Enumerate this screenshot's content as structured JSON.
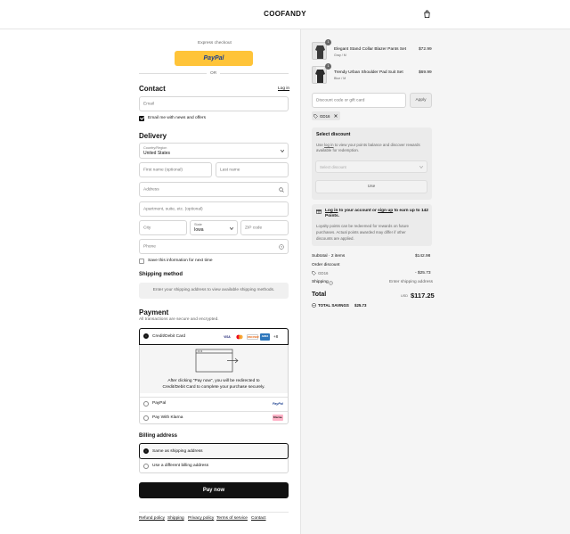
{
  "header": {
    "brand": "COOFANDY",
    "cart_icon": "shopping-bag-icon"
  },
  "express": {
    "label": "Express checkout",
    "paypal_label": "PayPal",
    "or": "OR"
  },
  "contact": {
    "title": "Contact",
    "login": "Log in",
    "email_placeholder": "Email",
    "newsletter_label": "Email me with news and offers",
    "newsletter_checked": true
  },
  "delivery": {
    "title": "Delivery",
    "country_label": "Country/Region",
    "country_value": "United States",
    "first_name_placeholder": "First name (optional)",
    "last_name_placeholder": "Last name",
    "address_placeholder": "Address",
    "apartment_placeholder": "Apartment, suite, etc. (optional)",
    "city_placeholder": "City",
    "state_label": "State",
    "state_value": "Iowa",
    "zip_placeholder": "ZIP code",
    "phone_placeholder": "Phone",
    "save_info_label": "Save this information for next time"
  },
  "shipping_method": {
    "title": "Shipping method",
    "message": "Enter your shipping address to view available shipping methods."
  },
  "payment": {
    "title": "Payment",
    "subtitle": "All transactions are secure and encrypted.",
    "card_label": "Credit/Debit Card",
    "card_brands": [
      "VISA",
      "MC",
      "DISCOVER",
      "AMEX"
    ],
    "more_brands": "+8",
    "redirect_text_1": "After clicking “Pay now”, you will be redirected to",
    "redirect_text_2": "Credit/Debit Card to complete your purchase securely.",
    "paypal_label": "PayPal",
    "paypal_logo": "PayPal",
    "klarna_label": "Pay With Klarna",
    "klarna_logo": "Klarna."
  },
  "billing": {
    "title": "Billing address",
    "same_label": "Same as shipping address",
    "different_label": "Use a different billing address"
  },
  "pay_button": "Pay now",
  "footer_links": [
    "Refund policy",
    "Shipping",
    "Privacy policy",
    "Terms of service",
    "Contact"
  ],
  "cart": {
    "items": [
      {
        "qty": "1",
        "name": "Elegant Stand Collar Blazer Pants Set",
        "variant": "Gray / M",
        "price": "$72.99"
      },
      {
        "qty": "1",
        "name": "Trendy Urban Shoulder Pad Suit Set",
        "variant": "Blue / M",
        "price": "$69.99"
      }
    ],
    "discount_placeholder": "Discount code or gift card",
    "apply_label": "Apply",
    "applied_code": "GD16"
  },
  "select_discount": {
    "title": "Select discount",
    "text_pre": "Use ",
    "login": "log in",
    "text_post": " to view your points balance and discover rewards",
    "text_line2": "available for redemption.",
    "dropdown_placeholder": "Select discount",
    "use_button": "Use"
  },
  "points": {
    "login": "Log in",
    "mid": " to your account or ",
    "signup": "sign up",
    "post": " to earn up to 142",
    "line2": "Points.",
    "note_1": "Loyalty points can be redeemed for rewards on future",
    "note_2": "purchases. Actual points awarded may differ if other",
    "note_3": "discounts are applied."
  },
  "summary": {
    "subtotal_label": "Subtotal · 2 items",
    "subtotal_value": "$142.98",
    "order_discount_label": "Order discount",
    "discount_code": "GD16",
    "discount_value": "- $25.73",
    "shipping_label": "Shipping",
    "shipping_value": "Enter shipping address",
    "total_label": "Total",
    "currency": "USD",
    "total_value": "$117.25",
    "savings_label": "TOTAL SAVINGS",
    "savings_value": "$25.73"
  }
}
